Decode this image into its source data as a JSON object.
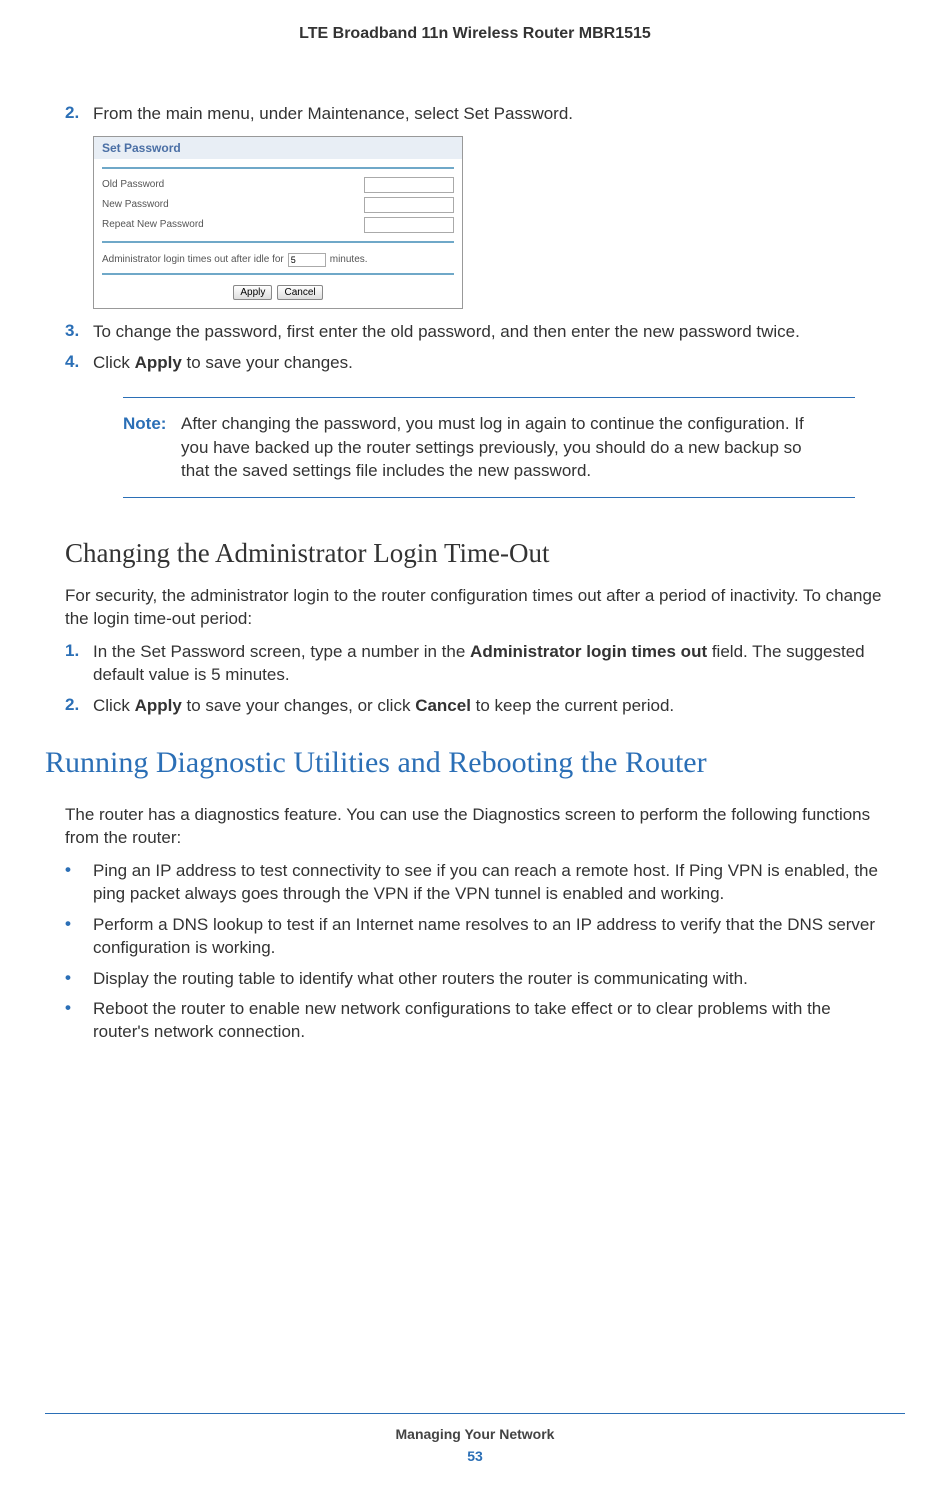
{
  "header": "LTE Broadband 11n Wireless Router MBR1515",
  "steps_a": {
    "s2_num": "2.",
    "s2_text": "From the main menu, under Maintenance, select Set Password.",
    "s3_num": "3.",
    "s3_text": "To change the password, first enter the old password, and then enter the new password twice.",
    "s4_num": "4.",
    "s4_text_a": "Click ",
    "s4_bold": "Apply",
    "s4_text_b": " to save your changes."
  },
  "screenshot": {
    "title": "Set Password",
    "old": "Old Password",
    "new": "New Password",
    "repeat": "Repeat New Password",
    "timeout_a": "Administrator login times out after idle for",
    "timeout_val": "5",
    "timeout_b": "minutes.",
    "apply": "Apply",
    "cancel": "Cancel"
  },
  "note": {
    "label": "Note:",
    "text": "After changing the password, you must log in again to continue the configuration. If you have backed up the router settings previously, you should do a new backup so that the saved settings file includes the new password."
  },
  "section_timeout": {
    "heading": "Changing the Administrator Login Time-Out",
    "intro": "For security, the administrator login to the router configuration times out after a period of inactivity. To change the login time-out period:",
    "s1_num": "1.",
    "s1_a": "In the Set Password screen, type a number in the ",
    "s1_bold": "Administrator login times out",
    "s1_b": " field. The suggested default value is 5 minutes.",
    "s2_num": "2.",
    "s2_a": "Click ",
    "s2_bold1": "Apply",
    "s2_b": " to save your changes, or click ",
    "s2_bold2": "Cancel",
    "s2_c": " to keep the current period."
  },
  "section_diag": {
    "heading": "Running Diagnostic Utilities and Rebooting the Router",
    "intro": "The router has a diagnostics feature. You can use the Diagnostics screen to perform the following functions from the router:",
    "b1": "Ping an IP address to test connectivity to see if you can reach a remote host. If Ping VPN is enabled, the ping packet always goes through the VPN if the VPN tunnel is enabled and working.",
    "b2": "Perform a DNS lookup to test if an Internet name resolves to an IP address to verify that the DNS server configuration is working.",
    "b3": "Display the routing table to identify what other routers the router is communicating with.",
    "b4": "Reboot the router to enable new network configurations to take effect or to clear problems with the router's network connection."
  },
  "footer": {
    "chapter": "Managing Your Network",
    "page": "53"
  },
  "bullet_char": "•"
}
